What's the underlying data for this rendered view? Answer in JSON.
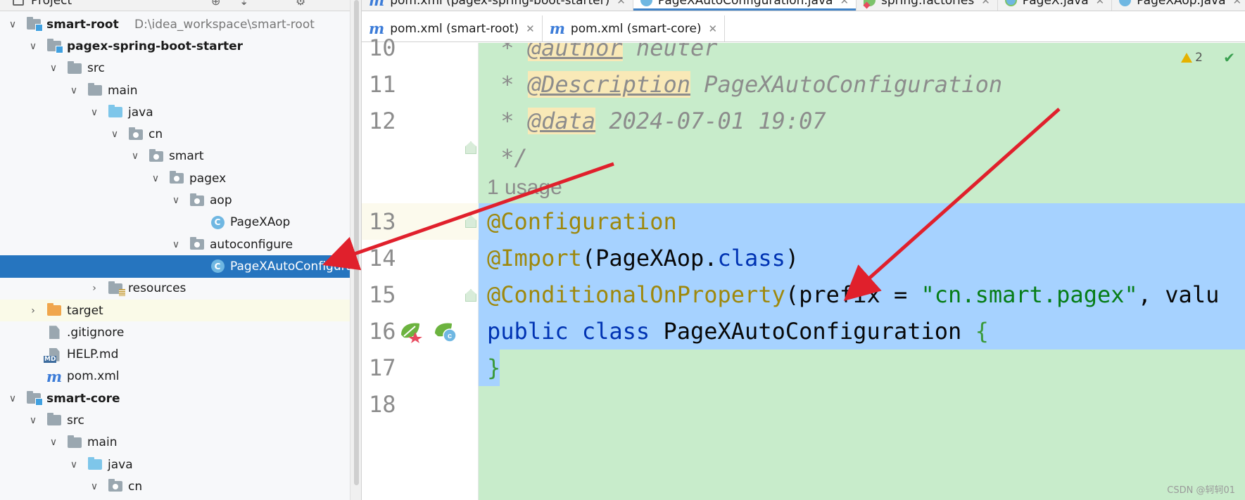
{
  "project_panel": {
    "title": "Project",
    "tree": [
      {
        "label": "smart-root",
        "path": "D:\\idea_workspace\\smart-root",
        "icon": "module-folder-icon",
        "bold": true,
        "chevron": "down"
      },
      {
        "label": "pagex-spring-boot-starter",
        "icon": "module-folder-icon",
        "bold": true,
        "chevron": "down"
      },
      {
        "label": "src",
        "icon": "folder-icon",
        "chevron": "down"
      },
      {
        "label": "main",
        "icon": "folder-icon",
        "chevron": "down"
      },
      {
        "label": "java",
        "icon": "source-folder-icon",
        "chevron": "down"
      },
      {
        "label": "cn",
        "icon": "package-icon",
        "chevron": "down"
      },
      {
        "label": "smart",
        "icon": "package-icon",
        "chevron": "down"
      },
      {
        "label": "pagex",
        "icon": "package-icon",
        "chevron": "down"
      },
      {
        "label": "aop",
        "icon": "package-icon",
        "chevron": "down"
      },
      {
        "label": "PageXAop",
        "icon": "class-icon",
        "chevron": "none"
      },
      {
        "label": "autoconfigure",
        "icon": "package-icon",
        "chevron": "down"
      },
      {
        "label": "PageXAutoConfiguration",
        "icon": "class-icon",
        "chevron": "none",
        "selected": true
      },
      {
        "label": "resources",
        "icon": "resources-folder-icon",
        "chevron": "right"
      },
      {
        "label": "target",
        "icon": "excluded-folder-icon",
        "chevron": "right",
        "highlight": true
      },
      {
        "label": ".gitignore",
        "icon": "ignore-file-icon",
        "chevron": "none"
      },
      {
        "label": "HELP.md",
        "icon": "markdown-file-icon",
        "chevron": "none"
      },
      {
        "label": "pom.xml",
        "icon": "maven-icon",
        "chevron": "none"
      },
      {
        "label": "smart-core",
        "icon": "module-folder-icon",
        "bold": true,
        "chevron": "down"
      },
      {
        "label": "src",
        "icon": "folder-icon",
        "chevron": "down"
      },
      {
        "label": "main",
        "icon": "folder-icon",
        "chevron": "down"
      },
      {
        "label": "java",
        "icon": "source-folder-icon",
        "chevron": "down"
      },
      {
        "label": "cn",
        "icon": "package-icon",
        "chevron": "down"
      }
    ]
  },
  "tabs_row1": [
    {
      "label": "pom.xml (pagex-spring-boot-starter)",
      "icon": "maven-icon"
    },
    {
      "label": "PageXAutoConfiguration.java",
      "icon": "class-icon",
      "active": true
    },
    {
      "label": "spring.factories",
      "icon": "spring-factories-icon"
    },
    {
      "label": "PageX.java",
      "icon": "class-green-icon"
    },
    {
      "label": "PageXAop.java",
      "icon": "class-icon"
    }
  ],
  "tabs_row2": [
    {
      "label": "pom.xml (smart-root)",
      "icon": "maven-icon"
    },
    {
      "label": "pom.xml (smart-core)",
      "icon": "maven-icon"
    }
  ],
  "editor": {
    "line_numbers": [
      "10",
      "11",
      "12",
      "13",
      "14",
      "15",
      "16",
      "17",
      "18"
    ],
    "code": {
      "l9_prefix": " * ",
      "l9_tag": "@author",
      "l9_text": " heuter",
      "l10_prefix": " * ",
      "l10_tag": "@Description",
      "l10_text": " PageXAutoConfiguration",
      "l11_prefix": " * ",
      "l11_tag": "@data",
      "l11_text": " 2024-07-01 19:07",
      "l12": " */",
      "usage": "1 usage",
      "l13": "@Configuration",
      "l14_ann": "@Import",
      "l14_open": "(",
      "l14_cls": "PageXAop",
      "l14_dot": ".",
      "l14_kw": "class",
      "l14_close": ")",
      "l15_ann": "@ConditionalOnProperty",
      "l15_open": "(",
      "l15_attr": "prefix = ",
      "l15_str": "\"cn.smart.pagex\"",
      "l15_rest": ", valu",
      "l16_kw1": "public",
      "l16_kw2": "class",
      "l16_name": " PageXAutoConfiguration ",
      "l16_brace": "{",
      "l17": "}"
    },
    "inspections_count": "2",
    "watermark": "CSDN @轲轲01"
  },
  "colors": {
    "selection": "#2675bf",
    "editor_background": "#c8eccb",
    "code_selection": "#a6d2ff",
    "arrow": "#e0202c"
  }
}
